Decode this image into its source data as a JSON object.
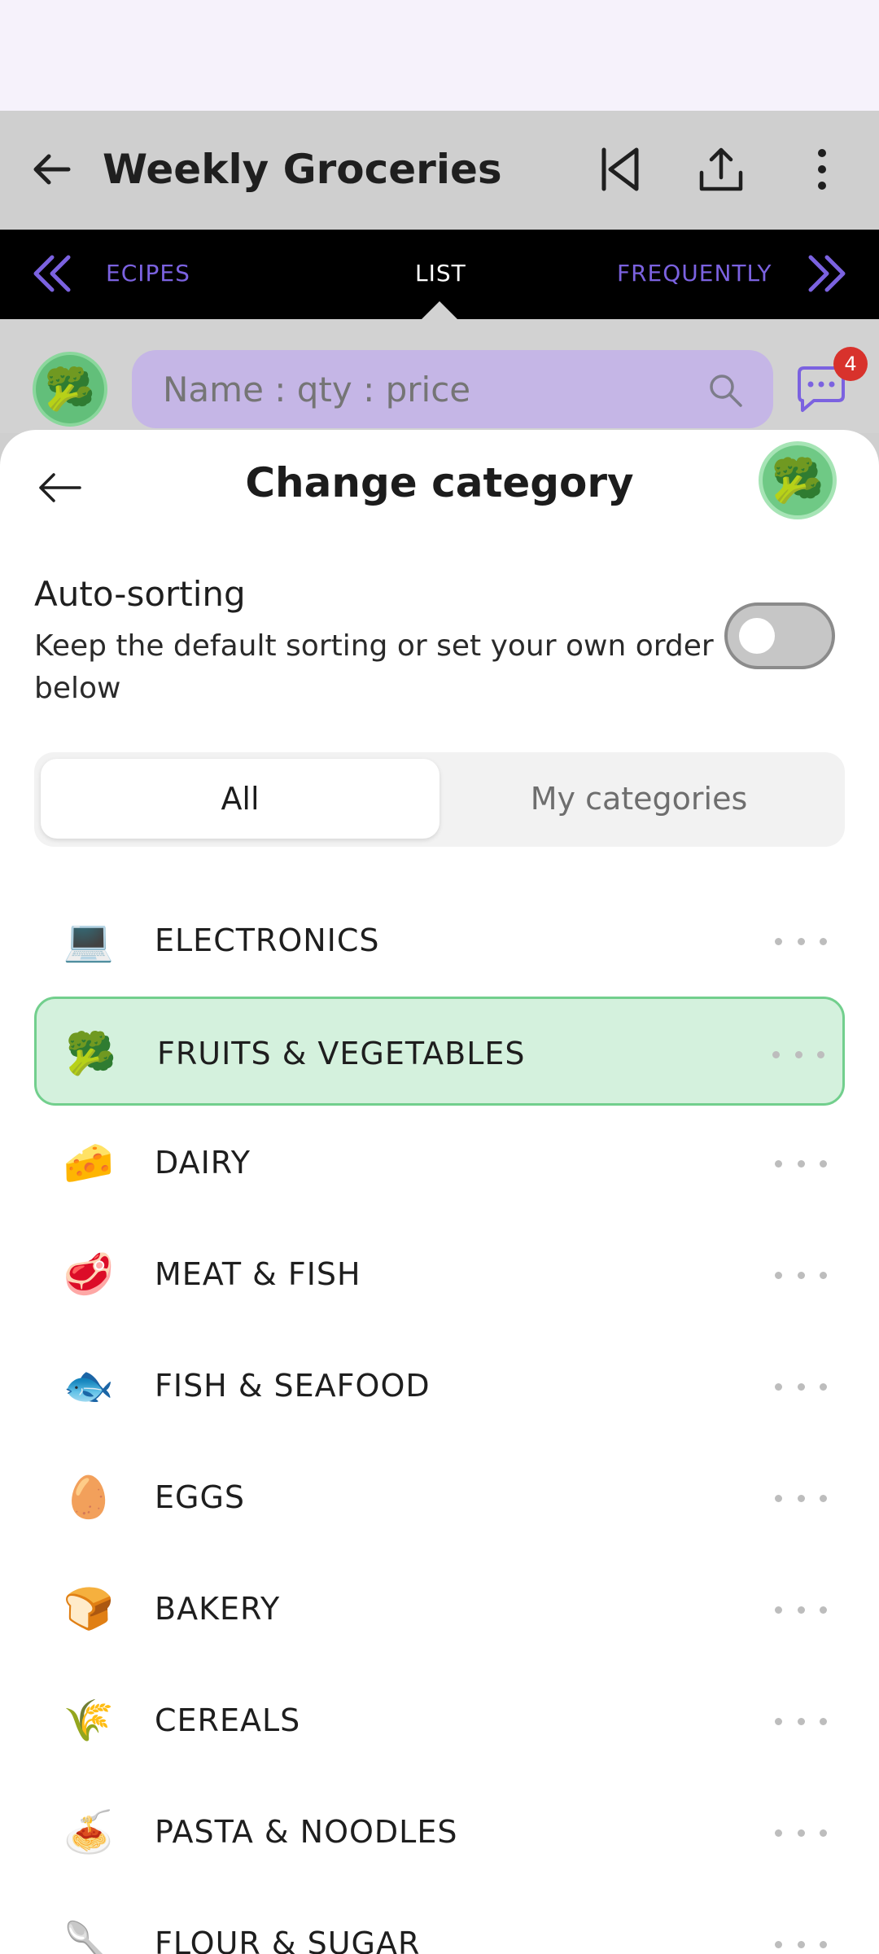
{
  "appbar": {
    "title": "Weekly Groceries",
    "icons": [
      "arrow-left-icon",
      "skip-previous-icon",
      "share-icon",
      "more-vert-icon"
    ]
  },
  "tabs": {
    "left": "ECIPES",
    "active": "LIST",
    "right": "FREQUENTLY",
    "inactive_color": "#7b62e0"
  },
  "input": {
    "placeholder": "Name : qty : price",
    "badge": "4"
  },
  "sheet": {
    "title": "Change category",
    "auto_title": "Auto-sorting",
    "auto_desc": "Keep the default sorting or set your own order below",
    "toggle_on": false,
    "segments": {
      "all": "All",
      "mine": "My categories"
    },
    "categories": [
      {
        "emoji": "💻",
        "label": "ELECTRONICS",
        "selected": false
      },
      {
        "emoji": "🥦",
        "label": "FRUITS & VEGETABLES",
        "selected": true
      },
      {
        "emoji": "🧀",
        "label": "DAIRY",
        "selected": false
      },
      {
        "emoji": "🥩",
        "label": "MEAT & FISH",
        "selected": false
      },
      {
        "emoji": "🐟",
        "label": "FISH & SEAFOOD",
        "selected": false
      },
      {
        "emoji": "🥚",
        "label": "EGGS",
        "selected": false
      },
      {
        "emoji": "🍞",
        "label": "BAKERY",
        "selected": false
      },
      {
        "emoji": "🌾",
        "label": "CEREALS",
        "selected": false
      },
      {
        "emoji": "🍝",
        "label": "PASTA & NOODLES",
        "selected": false
      },
      {
        "emoji": "🥄",
        "label": "FLOUR & SUGAR",
        "selected": false
      }
    ]
  },
  "colors": {
    "accent_green": "#72cf8d",
    "selected_bg": "#d4f1dd",
    "search_bg": "#c5b6e6",
    "badge": "#d8322c"
  }
}
